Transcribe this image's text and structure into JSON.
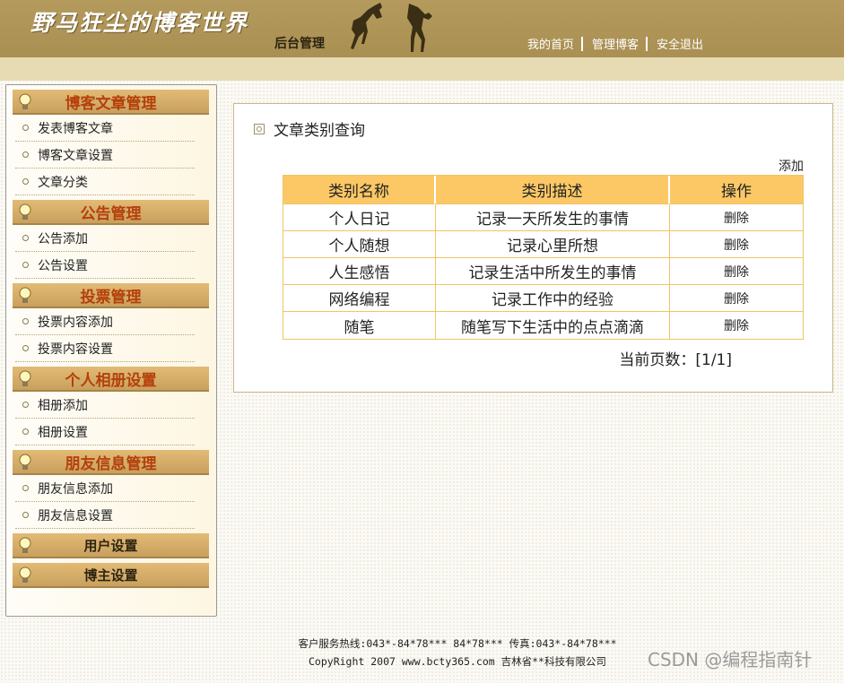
{
  "header": {
    "site_title": "野马狂尘的博客世界",
    "subtitle": "后台管理",
    "nav": [
      {
        "label": "我的首页"
      },
      {
        "label": "管理博客"
      },
      {
        "label": "安全退出"
      }
    ]
  },
  "sidebar": {
    "groups": [
      {
        "title": "博客文章管理",
        "items": [
          "发表博客文章",
          "博客文章设置",
          "文章分类"
        ]
      },
      {
        "title": "公告管理",
        "items": [
          "公告添加",
          "公告设置"
        ]
      },
      {
        "title": "投票管理",
        "items": [
          "投票内容添加",
          "投票内容设置"
        ]
      },
      {
        "title": "个人相册设置",
        "items": [
          "相册添加",
          "相册设置"
        ]
      },
      {
        "title": "朋友信息管理",
        "items": [
          "朋友信息添加",
          "朋友信息设置"
        ]
      },
      {
        "title": "用户设置",
        "items": []
      },
      {
        "title": "博主设置",
        "items": []
      }
    ]
  },
  "panel": {
    "title": "文章类别查询",
    "add_label": "添加",
    "table": {
      "headers": [
        "类别名称",
        "类别描述",
        "操作"
      ],
      "rows": [
        {
          "name": "个人日记",
          "desc": "记录一天所发生的事情",
          "op": "删除"
        },
        {
          "name": "个人随想",
          "desc": "记录心里所想",
          "op": "删除"
        },
        {
          "name": "人生感悟",
          "desc": "记录生活中所发生的事情",
          "op": "删除"
        },
        {
          "name": "网络编程",
          "desc": "记录工作中的经验",
          "op": "删除"
        },
        {
          "name": "随笔",
          "desc": "随笔写下生活中的点点滴滴",
          "op": "删除"
        }
      ]
    },
    "pager": "当前页数：[1/1]"
  },
  "footer": {
    "line1": "客户服务热线:043*-84*78*** 84*78*** 传真:043*-84*78***",
    "line2": "CopyRight 2007 www.bcty365.com 吉林省**科技有限公司"
  },
  "watermark": "CSDN @编程指南针",
  "colors": {
    "header_bg": "#b49a5c",
    "group_title_text": "#b4400b",
    "table_header_bg": "#fcc865",
    "table_border": "#f0c463"
  }
}
